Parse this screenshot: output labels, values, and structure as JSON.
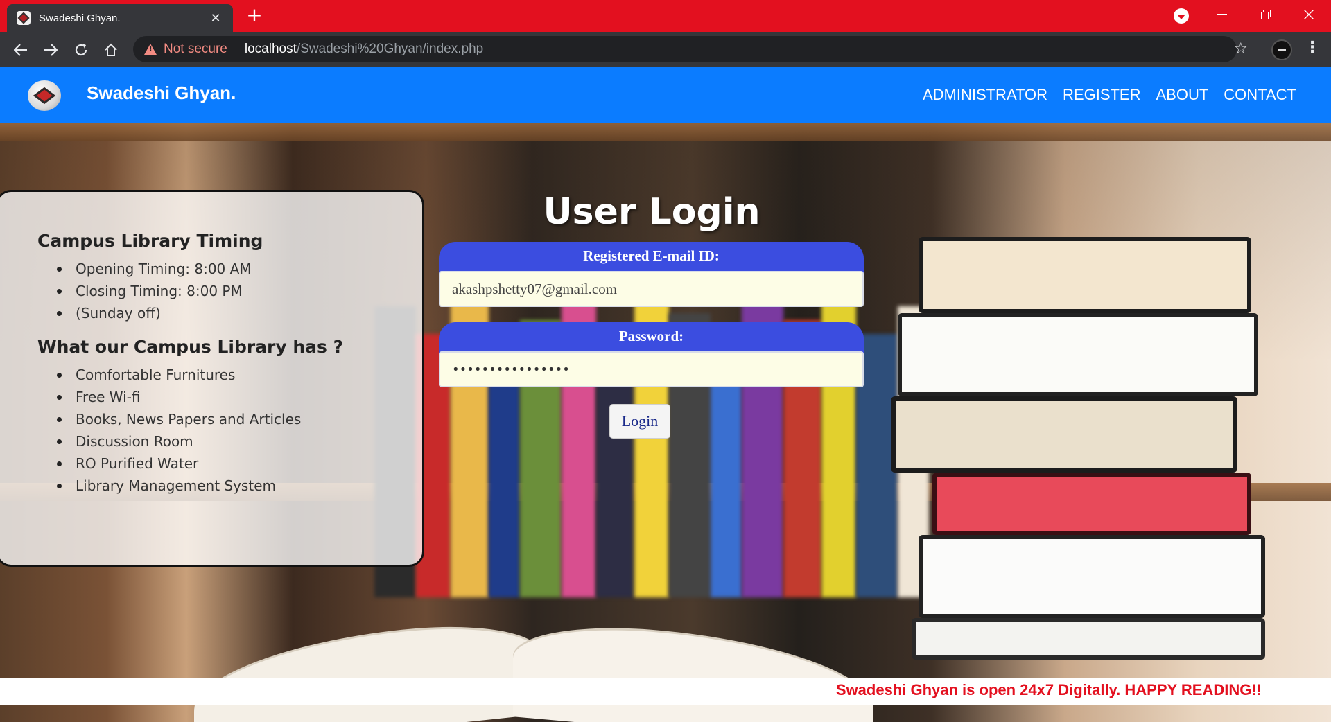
{
  "browser": {
    "tab_title": "Swadeshi Ghyan.",
    "tab_close": "✕",
    "new_tab": "+",
    "security_text": "Not secure",
    "url_host": "localhost",
    "url_path": "/Swadeshi%20Ghyan/index.php",
    "icons": [
      "back-icon",
      "forward-icon",
      "reload-icon",
      "home-icon",
      "star-icon",
      "account-icon",
      "menu-icon"
    ]
  },
  "header": {
    "brand": "Swadeshi Ghyan.",
    "nav": [
      "ADMINISTRATOR",
      "REGISTER",
      "ABOUT",
      "CONTACT"
    ]
  },
  "info": {
    "timing_heading": "Campus Library Timing",
    "timing_items": [
      "Opening Timing: 8:00 AM",
      "Closing Timing: 8:00 PM",
      "(Sunday off)"
    ],
    "facilities_heading": "What our Campus Library has ?",
    "facilities_items": [
      "Comfortable Furnitures",
      "Free Wi-fi",
      "Books, News Papers and Articles",
      "Discussion Room",
      "RO Purified Water",
      "Library Management System"
    ]
  },
  "login": {
    "title": "User Login",
    "email_label": "Registered E-mail ID:",
    "email_value": "akashpshetty07@gmail.com",
    "password_label": "Password:",
    "password_value": "••••••••••••••••",
    "button": "Login"
  },
  "banner": {
    "text": "Swadeshi Ghyan is open 24x7 Digitally. HAPPY READING!!"
  },
  "colors": {
    "tabstrip": "#e3101f",
    "header": "#0b7cff",
    "label_bg": "#3b4de0",
    "banner_text": "#e3101f"
  }
}
